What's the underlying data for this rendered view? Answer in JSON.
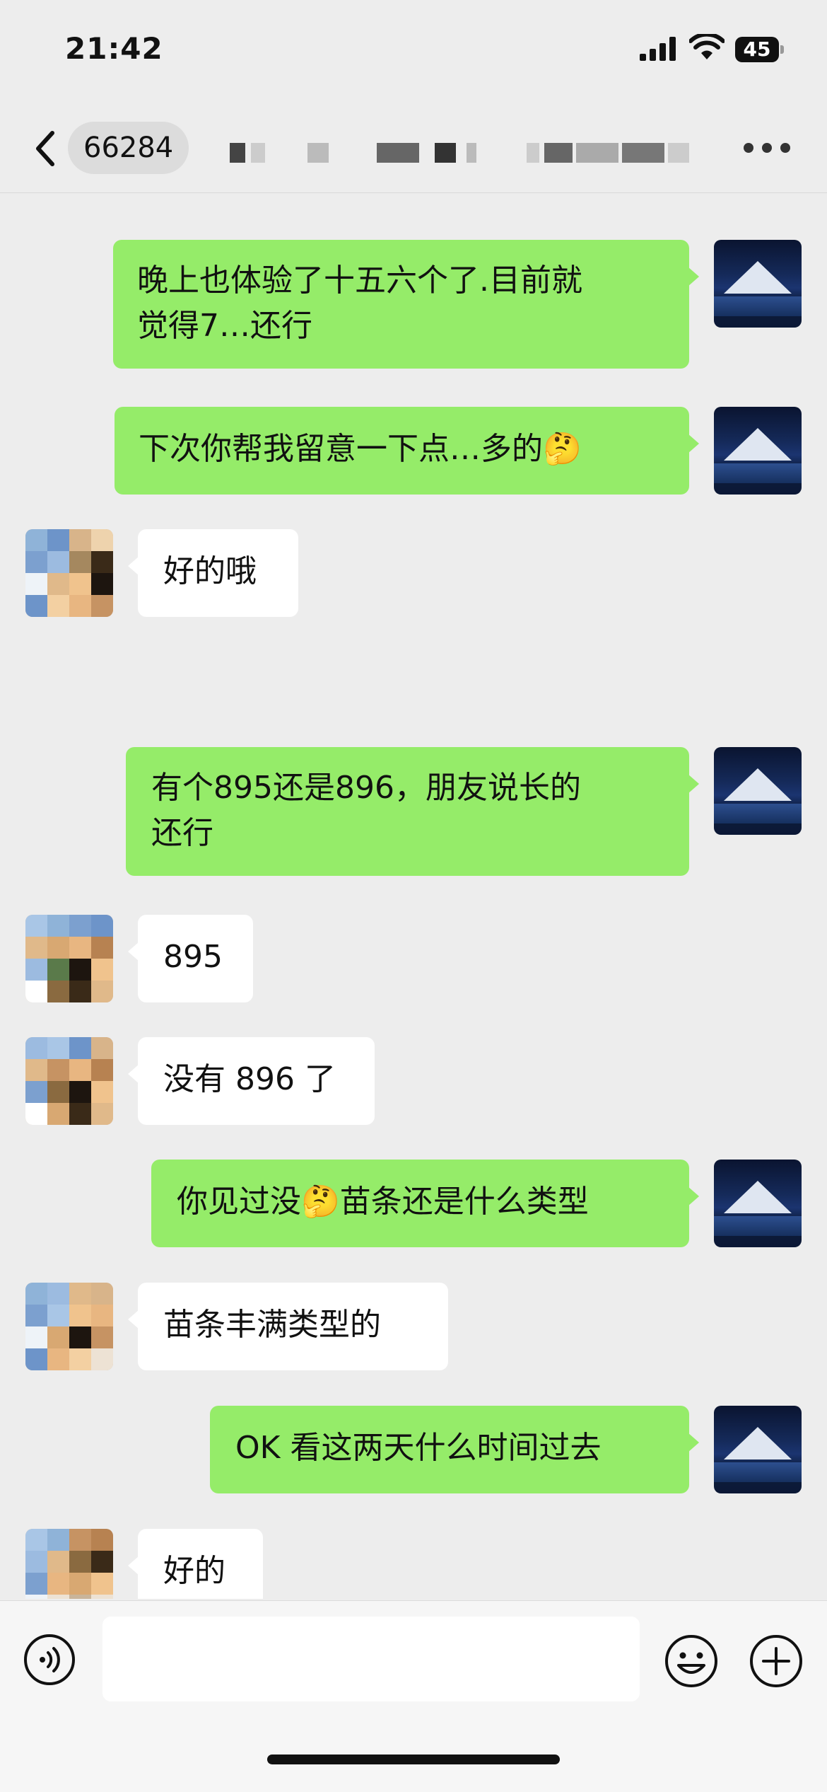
{
  "status_bar": {
    "time": "21:42",
    "battery": "45"
  },
  "header": {
    "unread_count": "66284"
  },
  "messages": [
    {
      "side": "right",
      "lines": [
        "晚上也体验了十五六个了.目前就",
        "觉得7…还行"
      ]
    },
    {
      "side": "right",
      "lines": [
        "下次你帮我留意一下点…多的🤔"
      ]
    },
    {
      "side": "left",
      "lines": [
        "好的哦"
      ]
    },
    {
      "side": "right",
      "lines": [
        "有个895还是896，朋友说长的",
        "还行"
      ]
    },
    {
      "side": "left",
      "lines": [
        "895"
      ]
    },
    {
      "side": "left",
      "lines": [
        "没有 896 了"
      ]
    },
    {
      "side": "right",
      "lines": [
        "你见过没🤔苗条还是什么类型"
      ]
    },
    {
      "side": "left",
      "lines": [
        "苗条丰满类型的"
      ]
    },
    {
      "side": "right",
      "lines": [
        "OK 看这两天什么时间过去"
      ]
    },
    {
      "side": "left",
      "lines": [
        "好的"
      ]
    }
  ],
  "colors": {
    "self_bubble": "#95ec69",
    "other_bubble": "#ffffff",
    "background": "#ededed"
  },
  "icons": [
    "back-icon",
    "more-icon",
    "voice-icon",
    "emoji-icon",
    "plus-icon"
  ]
}
